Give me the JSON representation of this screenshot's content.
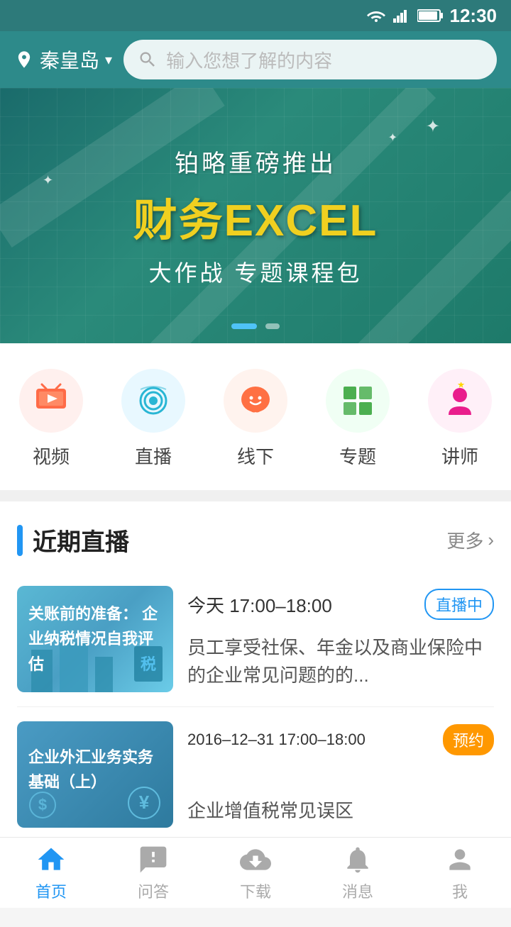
{
  "statusBar": {
    "time": "12:30"
  },
  "topNav": {
    "location": "秦皇岛",
    "searchPlaceholder": "输入您想了解的内容"
  },
  "banner": {
    "subtitle": "铂略重磅推出",
    "title": "财务EXCEL",
    "desc": "大作战 专题课程包",
    "dots": [
      true,
      false
    ]
  },
  "categories": [
    {
      "id": "video",
      "label": "视频",
      "colorClass": "icon-video"
    },
    {
      "id": "live",
      "label": "直播",
      "colorClass": "icon-live"
    },
    {
      "id": "offline",
      "label": "线下",
      "colorClass": "icon-offline"
    },
    {
      "id": "topic",
      "label": "专题",
      "colorClass": "icon-topic"
    },
    {
      "id": "teacher",
      "label": "讲师",
      "colorClass": "icon-teacher"
    }
  ],
  "recentLive": {
    "sectionTitle": "近期直播",
    "moreLabel": "更多",
    "items": [
      {
        "thumbText": "关账前的准备：\n企业纳税情况自我评估",
        "time": "今天 17:00–18:00",
        "statusLabel": "直播中",
        "statusType": "live",
        "desc": "员工享受社保、年金以及商业保险中的企业常见问题的的..."
      },
      {
        "thumbText": "企业外汇业务实务基础（上）",
        "time": "2016–12–31  17:00–18:00",
        "statusLabel": "预约",
        "statusType": "reserve",
        "desc": "企业增值税常见误区"
      }
    ]
  },
  "bottomNav": {
    "items": [
      {
        "id": "home",
        "label": "首页",
        "active": true
      },
      {
        "id": "qa",
        "label": "问答",
        "active": false
      },
      {
        "id": "download",
        "label": "下载",
        "active": false
      },
      {
        "id": "message",
        "label": "消息",
        "active": false
      },
      {
        "id": "me",
        "label": "我",
        "active": false
      }
    ]
  }
}
